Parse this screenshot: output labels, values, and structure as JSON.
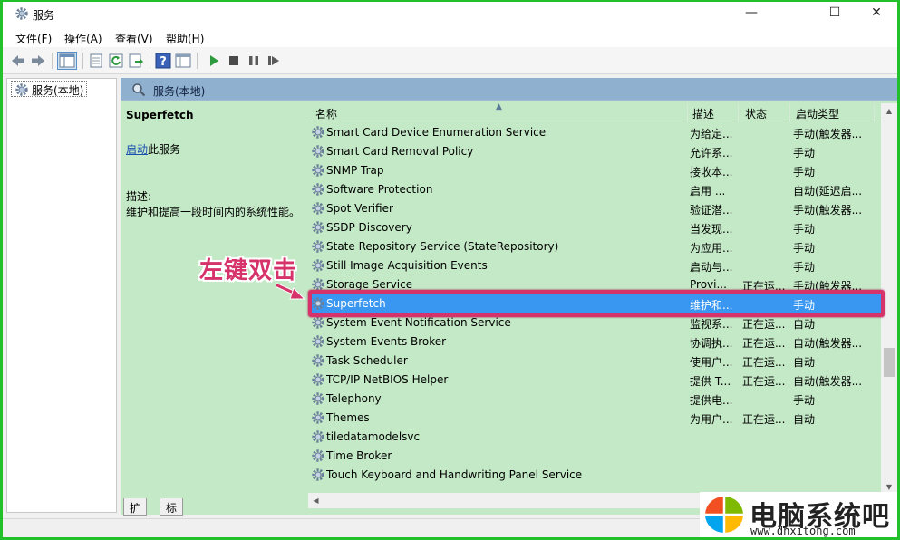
{
  "window": {
    "title": "服务",
    "minimize_glyph": "—",
    "maximize_glyph": "☐",
    "close_glyph": "✕"
  },
  "menu": [
    "文件(F)",
    "操作(A)",
    "查看(V)",
    "帮助(H)"
  ],
  "toolbar_icons": [
    "back-icon",
    "forward-icon",
    "console-tree-icon",
    "properties-icon",
    "refresh-icon",
    "export-icon",
    "help-icon",
    "view-icon",
    "start-icon",
    "stop-icon",
    "pause-icon",
    "restart-icon"
  ],
  "tree": {
    "root": "服务(本地)"
  },
  "pane": {
    "header": "服务(本地)",
    "selected_name": "Superfetch",
    "start_link": "启动",
    "start_suffix": "此服务",
    "desc_label": "描述:",
    "desc_text": "维护和提高一段时间内的系统性能。"
  },
  "columns": {
    "name": "名称",
    "desc": "描述",
    "status": "状态",
    "startup": "启动类型"
  },
  "services": [
    {
      "name": "Smart Card Device Enumeration Service",
      "desc": "为给定...",
      "status": "",
      "startup": "手动(触发器..."
    },
    {
      "name": "Smart Card Removal Policy",
      "desc": "允许系...",
      "status": "",
      "startup": "手动"
    },
    {
      "name": "SNMP Trap",
      "desc": "接收本...",
      "status": "",
      "startup": "手动"
    },
    {
      "name": "Software Protection",
      "desc": "启用 ...",
      "status": "",
      "startup": "自动(延迟启..."
    },
    {
      "name": "Spot Verifier",
      "desc": "验证潜...",
      "status": "",
      "startup": "手动(触发器..."
    },
    {
      "name": "SSDP Discovery",
      "desc": "当发现...",
      "status": "",
      "startup": "手动"
    },
    {
      "name": "State Repository Service (StateRepository)",
      "desc": "为应用...",
      "status": "",
      "startup": "手动"
    },
    {
      "name": "Still Image Acquisition Events",
      "desc": "启动与...",
      "status": "",
      "startup": "手动"
    },
    {
      "name": "Storage Service",
      "desc": "Provi...",
      "status": "正在运...",
      "startup": "手动(触发器..."
    },
    {
      "name": "Superfetch",
      "desc": "维护和...",
      "status": "",
      "startup": "手动"
    },
    {
      "name": "System Event Notification Service",
      "desc": "监视系...",
      "status": "正在运...",
      "startup": "自动"
    },
    {
      "name": "System Events Broker",
      "desc": "协调执...",
      "status": "正在运...",
      "startup": "自动(触发器..."
    },
    {
      "name": "Task Scheduler",
      "desc": "使用户...",
      "status": "正在运...",
      "startup": "自动"
    },
    {
      "name": "TCP/IP NetBIOS Helper",
      "desc": "提供 T...",
      "status": "正在运...",
      "startup": "自动(触发器..."
    },
    {
      "name": "Telephony",
      "desc": "提供电...",
      "status": "",
      "startup": "手动"
    },
    {
      "name": "Themes",
      "desc": "为用户...",
      "status": "正在运...",
      "startup": "自动"
    },
    {
      "name": "tiledatamodelsvc",
      "desc": "",
      "status": "",
      "startup": ""
    },
    {
      "name": "Time Broker",
      "desc": "",
      "status": "",
      "startup": ""
    },
    {
      "name": "Touch Keyboard and Handwriting Panel Service",
      "desc": "",
      "status": "",
      "startup": ""
    }
  ],
  "selected_index": 9,
  "annotation": "左键双击",
  "tabs": [
    "扩展",
    "标准"
  ],
  "watermark": {
    "title": "电脑系统吧",
    "url": "www.dnxitong.com"
  },
  "colors": {
    "selection": "#3a97f1",
    "highlight_border": "#d6336a",
    "pane_bg": "#c4e9c6",
    "header_bg": "#8fb0cf",
    "frame": "#22c02a"
  }
}
